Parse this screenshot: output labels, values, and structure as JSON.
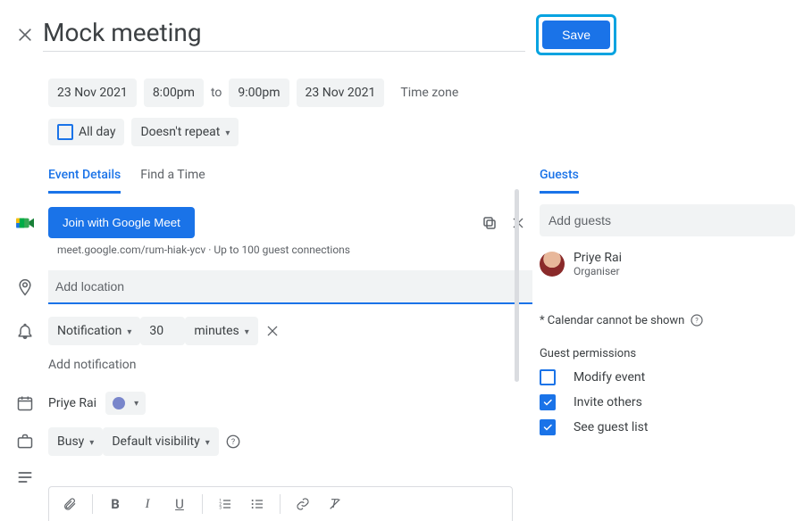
{
  "header": {
    "title": "Mock meeting",
    "save_label": "Save"
  },
  "datetime": {
    "start_date": "23 Nov 2021",
    "start_time": "8:00pm",
    "to_label": "to",
    "end_time": "9:00pm",
    "end_date": "23 Nov 2021",
    "timezone_label": "Time zone"
  },
  "options": {
    "all_day_label": "All day",
    "repeat_label": "Doesn't repeat"
  },
  "tabs": {
    "details": "Event Details",
    "find_time": "Find a Time"
  },
  "meet": {
    "join_label": "Join with Google Meet",
    "link": "meet.google.com/rum-hiak-ycv",
    "sep": " · ",
    "capacity": "Up to 100 guest connections"
  },
  "location": {
    "placeholder": "Add location"
  },
  "notification": {
    "type": "Notification",
    "value": "30",
    "unit": "minutes",
    "add_label": "Add notification"
  },
  "calendar": {
    "owner": "Priye Rai"
  },
  "visibility": {
    "busy": "Busy",
    "default": "Default visibility"
  },
  "guests": {
    "tab": "Guests",
    "placeholder": "Add guests",
    "organiser_name": "Priye Rai",
    "organiser_role": "Organiser",
    "warning": "* Calendar cannot be shown",
    "perm_title": "Guest permissions",
    "perm_modify": "Modify event",
    "perm_invite": "Invite others",
    "perm_seelist": "See guest list"
  }
}
